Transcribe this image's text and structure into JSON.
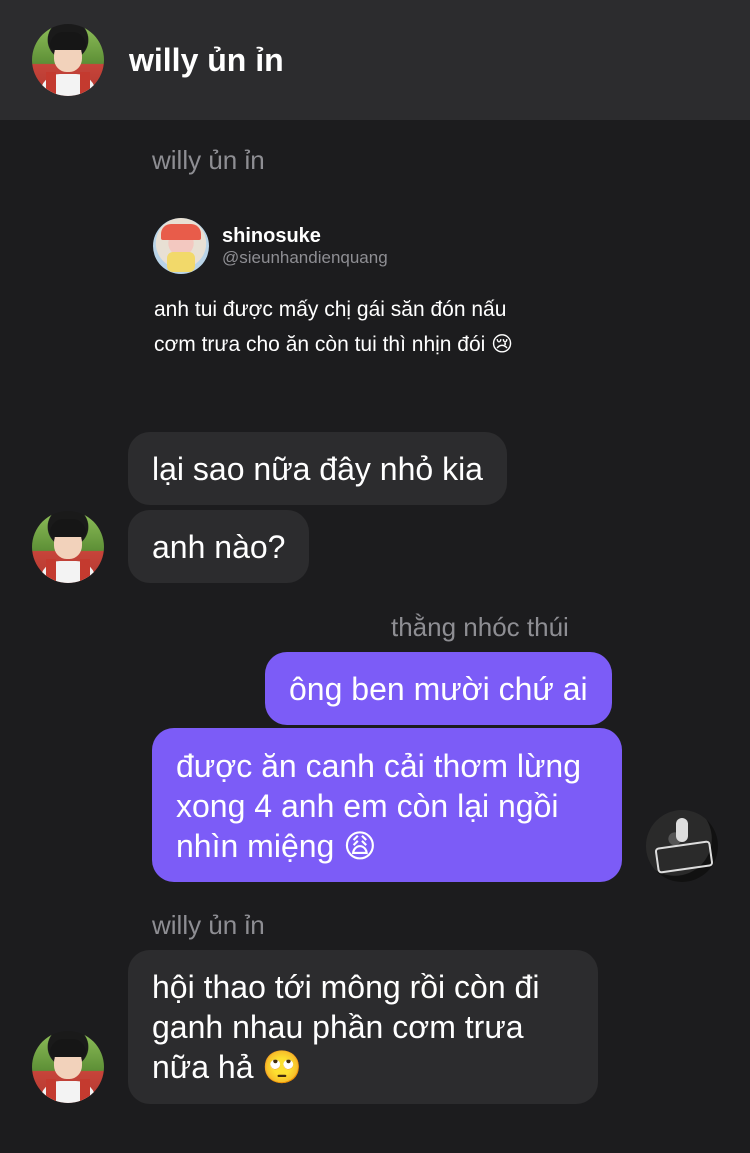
{
  "header": {
    "name": "willy ủn ỉn"
  },
  "messages": {
    "sender_1": "willy ủn ỉn",
    "quote": {
      "name": "shinosuke",
      "handle": "@sieunhandienquang",
      "text": "anh tui được mấy chị gái săn đón nấu cơm trưa cho ăn còn tui thì nhịn đói 😢"
    },
    "m1": "lại sao nữa đây nhỏ kia",
    "m2": "anh nào?",
    "sender_2": "thằng nhóc thúi",
    "m3": "ông ben mười chứ ai",
    "m4": "được ăn canh cải thơm lừng xong 4 anh em còn lại ngồi nhìn miệng 😩",
    "sender_3": "willy ủn ỉn",
    "m5": "hội thao tới mông rồi còn đi ganh nhau phần cơm trưa nữa hả 🙄"
  },
  "colors": {
    "incoming": "#2c2c2e",
    "outgoing": "#7c5cf7",
    "background": "#1c1c1e",
    "header": "#2c2c2e"
  },
  "icons": {
    "contact_avatar": "kid-avatar",
    "self_avatar": "dark-avatar"
  }
}
